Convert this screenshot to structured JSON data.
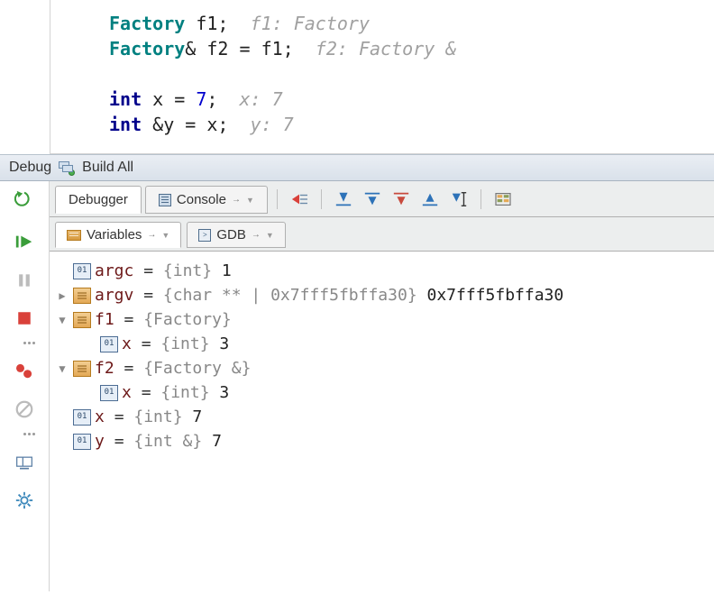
{
  "editor": {
    "lines": [
      {
        "pre": "Factory",
        "rest": " f1;  ",
        "hint": "f1: Factory",
        "kind": "type"
      },
      {
        "pre": "Factory",
        "rest": "& f2 = f1;  ",
        "hint": "f2: Factory &",
        "kind": "type"
      },
      {
        "blank": true
      },
      {
        "pre": "int",
        "rest": " x = ",
        "num": "7",
        "post": ";  ",
        "hint": "x: 7",
        "kind": "kw"
      },
      {
        "pre": "int",
        "rest": " &y = x;  ",
        "hint": "y: 7",
        "kind": "kw"
      }
    ]
  },
  "debugbar": {
    "debug": "Debug",
    "build": "Build All"
  },
  "tabs": {
    "debugger": "Debugger",
    "console": "Console"
  },
  "subtabs": {
    "variables": "Variables",
    "gdb": "GDB"
  },
  "vars": [
    {
      "indent": 1,
      "disclosure": "",
      "chip": "prim",
      "name": "argc",
      "type": "{int}",
      "value": "1"
    },
    {
      "indent": 1,
      "disclosure": "right",
      "chip": "obj",
      "name": "argv",
      "type": "{char ** | 0x7fff5fbffa30}",
      "value": "0x7fff5fbffa30"
    },
    {
      "indent": 1,
      "disclosure": "down",
      "chip": "obj",
      "name": "f1",
      "type": "{Factory}",
      "value": ""
    },
    {
      "indent": 2,
      "disclosure": "",
      "chip": "prim",
      "name": "x",
      "type": "{int}",
      "value": "3"
    },
    {
      "indent": 1,
      "disclosure": "down",
      "chip": "obj",
      "name": "f2",
      "type": "{Factory &}",
      "value": ""
    },
    {
      "indent": 2,
      "disclosure": "",
      "chip": "prim",
      "name": "x",
      "type": "{int}",
      "value": "3"
    },
    {
      "indent": 1,
      "disclosure": "",
      "chip": "prim",
      "name": "x",
      "type": "{int}",
      "value": "7"
    },
    {
      "indent": 1,
      "disclosure": "",
      "chip": "prim",
      "name": "y",
      "type": "{int &}",
      "value": "7"
    }
  ]
}
